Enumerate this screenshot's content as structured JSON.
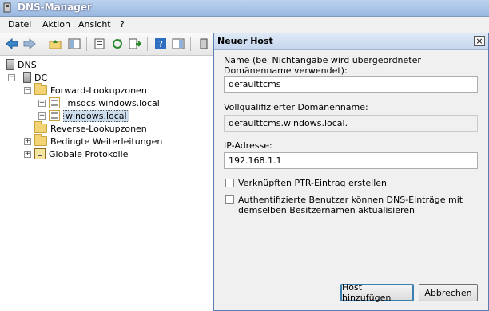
{
  "window": {
    "title": "DNS-Manager"
  },
  "menu": [
    "Datei",
    "Aktion",
    "Ansicht",
    "?"
  ],
  "tree": {
    "root": "DNS",
    "server": "DC",
    "forward": "Forward-Lookupzonen",
    "msdcs": "_msdcs.windows.local",
    "zone": "windows.local",
    "reverse": "Reverse-Lookupzonen",
    "conditional": "Bedingte Weiterleitungen",
    "logs": "Globale Protokolle"
  },
  "dialog": {
    "title": "Neuer Host",
    "close": "×",
    "name_label": "Name (bei Nichtangabe wird übergeordneter Domänenname verwendet):",
    "name_value": "defaulttcms",
    "fqdn_label": "Vollqualifizierter Domänenname:",
    "fqdn_value": "defaulttcms.windows.local.",
    "ip_label": "IP-Adresse:",
    "ip_value": "192.168.1.1",
    "ptr_label": "Verknüpften PTR-Eintrag erstellen",
    "ptr_checked": false,
    "auth_label": "Authentifizierte Benutzer können DNS-Einträge mit demselben Besitzernamen aktualisieren",
    "auth_checked": false,
    "add_button": "Host hinzufügen",
    "cancel_button": "Abbrechen"
  },
  "colors": {
    "accent": "#3c7fb1",
    "titlebar": "#9ab8e0"
  }
}
